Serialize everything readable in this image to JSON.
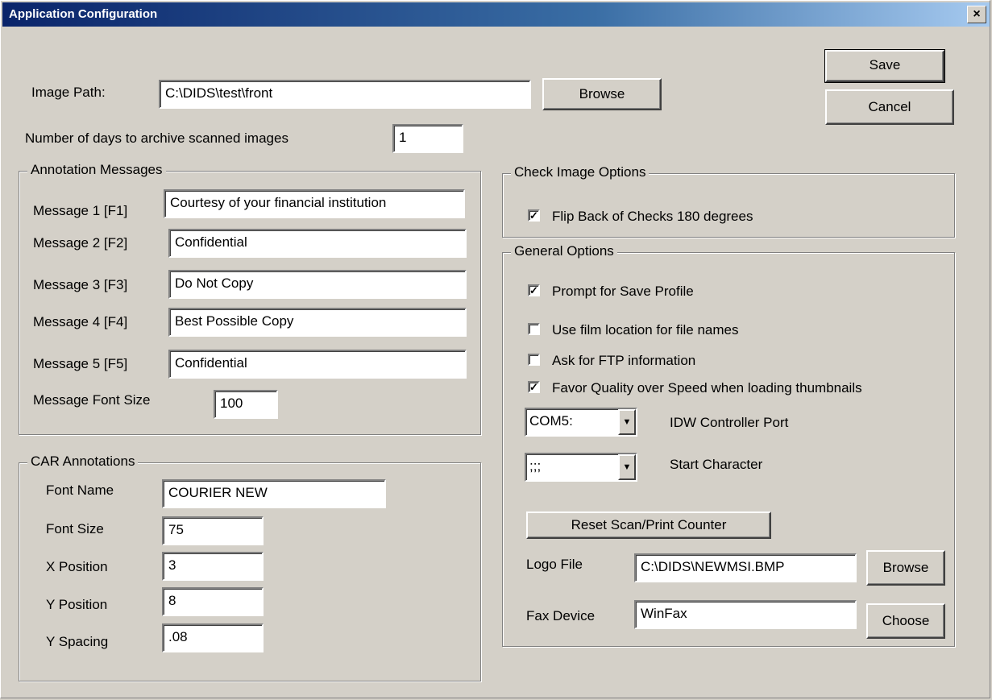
{
  "window": {
    "title": "Application Configuration",
    "close_glyph": "×"
  },
  "buttons": {
    "save": "Save",
    "cancel": "Cancel",
    "browse_image": "Browse",
    "reset_counter": "Reset Scan/Print Counter",
    "browse_logo": "Browse",
    "choose_fax": "Choose"
  },
  "image_path": {
    "label": "Image Path:",
    "value": "C:\\DIDS\\test\\front"
  },
  "archive_days": {
    "label": "Number of days to archive scanned images",
    "value": "1"
  },
  "annotation_messages": {
    "legend": "Annotation Messages",
    "items": [
      {
        "label": "Message 1 [F1]",
        "value": "Courtesy of your financial institution"
      },
      {
        "label": "Message 2 [F2]",
        "value": "Confidential"
      },
      {
        "label": "Message 3 [F3]",
        "value": "Do Not Copy"
      },
      {
        "label": "Message 4 [F4]",
        "value": "Best Possible Copy"
      },
      {
        "label": "Message 5 [F5]",
        "value": "Confidential"
      }
    ],
    "font_size_label": "Message Font Size",
    "font_size_value": "100"
  },
  "car_annotations": {
    "legend": "CAR Annotations",
    "font_name": {
      "label": "Font Name",
      "value": "COURIER NEW"
    },
    "font_size": {
      "label": "Font Size",
      "value": "75"
    },
    "x_position": {
      "label": "X Position",
      "value": "3"
    },
    "y_position": {
      "label": "Y Position",
      "value": "8"
    },
    "y_spacing": {
      "label": "Y Spacing",
      "value": ".08"
    }
  },
  "check_image_options": {
    "legend": "Check Image Options",
    "flip_back": {
      "label": "Flip Back of Checks 180 degrees",
      "checked": true
    }
  },
  "general_options": {
    "legend": "General Options",
    "checks": [
      {
        "label": "Prompt for Save Profile",
        "checked": true
      },
      {
        "label": "Use film location for file names",
        "checked": false
      },
      {
        "label": "Ask for FTP information",
        "checked": false
      },
      {
        "label": "Favor Quality over Speed when loading thumbnails",
        "checked": true
      }
    ],
    "controller_port": {
      "label": "IDW Controller Port",
      "value": "COM5:"
    },
    "start_character": {
      "label": "Start Character",
      "value": ";;;"
    },
    "logo_file": {
      "label": "Logo File",
      "value": "C:\\DIDS\\NEWMSI.BMP"
    },
    "fax_device": {
      "label": "Fax Device",
      "value": "WinFax"
    }
  },
  "check_mark": "✓",
  "combo_arrow_glyph": "▼",
  "colors": {
    "face": "#d4d0c8",
    "title_start": "#0a246a",
    "title_end": "#a6caf0"
  }
}
